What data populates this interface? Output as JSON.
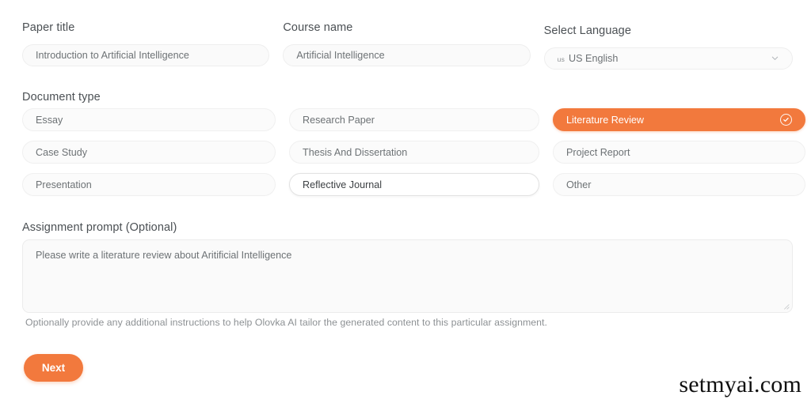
{
  "form": {
    "paper_title": {
      "label": "Paper title",
      "value": "Introduction to Artificial Intelligence",
      "placeholder": "Paper title"
    },
    "course_name": {
      "label": "Course name",
      "value": "Artificial Intelligence",
      "placeholder": "Course name"
    },
    "language": {
      "label": "Select Language",
      "flag_code": "us",
      "value": "US English",
      "chevron_icon": "chevron-down-icon"
    },
    "document_type": {
      "label": "Document type",
      "options": [
        {
          "label": "Essay",
          "state": "default"
        },
        {
          "label": "Research Paper",
          "state": "default"
        },
        {
          "label": "Literature Review",
          "state": "selected"
        },
        {
          "label": "Case Study",
          "state": "default"
        },
        {
          "label": "Thesis And Dissertation",
          "state": "default"
        },
        {
          "label": "Project Report",
          "state": "default"
        },
        {
          "label": "Presentation",
          "state": "default"
        },
        {
          "label": "Reflective Journal",
          "state": "hover"
        },
        {
          "label": "Other",
          "state": "default"
        }
      ],
      "selected_check_icon": "check-circle-icon"
    },
    "assignment_prompt": {
      "label": "Assignment prompt (Optional)",
      "value": "Please write a literature review about Aritificial Intelligence",
      "placeholder": "Assignment prompt",
      "helper": "Optionally provide any additional instructions to help Olovka AI tailor the generated content to this particular assignment.",
      "resize_icon": "resize-grip-icon"
    },
    "next_button": {
      "label": "Next"
    }
  },
  "watermark": {
    "text": "setmyai.com"
  },
  "colors": {
    "accent": "#F2793D",
    "label_text": "#4B5054",
    "value_text": "#6D7275",
    "helper_text": "#8D9194",
    "field_bg": "#FAFAFA",
    "field_border": "#EEEEEE",
    "page_bg": "#FFFFFF"
  }
}
